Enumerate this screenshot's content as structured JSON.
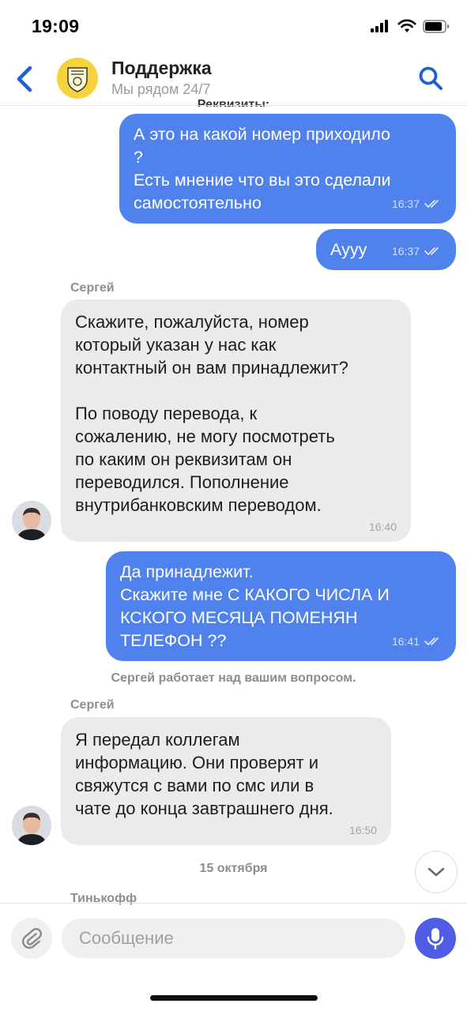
{
  "status_bar": {
    "time": "19:09"
  },
  "header": {
    "title": "Поддержка",
    "subtitle": "Мы рядом 24/7",
    "cut_text": "Реквизиты:",
    "icons": [
      "back-arrow-icon",
      "bank-logo",
      "search-icon"
    ]
  },
  "messages": [
    {
      "type": "outgoing",
      "text": "А это на какой номер приходило\n?\nЕсть мнение что вы это сделали\nсамостоятельно",
      "time": "16:37"
    },
    {
      "type": "outgoing",
      "text": "Аууу",
      "time": "16:37"
    },
    {
      "type": "incoming",
      "sender": "Сергей",
      "text": "Скажите, пожалуйста, номер\nкоторый указан у нас как\nконтактный он вам принадлежит?\n\nПо поводу перевода, к\nсожалению, не могу посмотреть\nпо каким он реквизитам он\nпереводился. Пополнение\nвнутрибанковским переводом.",
      "time": "16:40"
    },
    {
      "type": "outgoing",
      "text": "Да принадлежит.\nСкажите мне С КАКОГО ЧИСЛА И\nКСКОГО МЕСЯЦА ПОМЕНЯН\nТЕЛЕФОН ??",
      "time": "16:41"
    },
    {
      "type": "system",
      "text": "Сергей работает над вашим вопросом."
    },
    {
      "type": "incoming",
      "sender": "Сергей",
      "text": "Я передал коллегам\nинформацию. Они проверят и\nсвяжутся с вами по смс или в\nчате до конца завтрашнего дня.",
      "time": "16:50"
    },
    {
      "type": "date",
      "text": "15 октября"
    },
    {
      "type": "sender_only",
      "sender": "Тинькофф"
    }
  ],
  "composer": {
    "placeholder": "Сообщение"
  },
  "colors": {
    "outgoing_bubble": "#4f82ec",
    "incoming_bubble": "#ebebeb",
    "accent": "#1f5fd6",
    "mic_button": "#4f5ce6"
  }
}
